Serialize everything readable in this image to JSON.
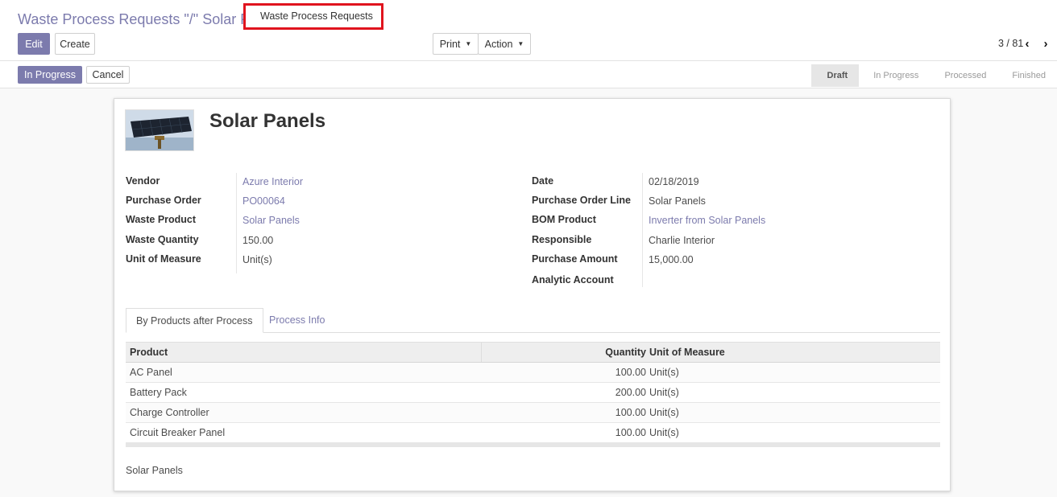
{
  "breadcrumb": "Waste Process Requests \"/\" Solar Panels",
  "tooltip": "Waste Process Requests",
  "buttons": {
    "edit": "Edit",
    "create": "Create",
    "print": "Print",
    "action": "Action"
  },
  "pager": {
    "value": "3 / 81"
  },
  "statusbar": {
    "buttons": {
      "in_progress": "In Progress",
      "cancel": "Cancel"
    },
    "stages": [
      {
        "label": "Draft",
        "active": true
      },
      {
        "label": "In Progress",
        "active": false
      },
      {
        "label": "Processed",
        "active": false
      },
      {
        "label": "Finished",
        "active": false
      }
    ]
  },
  "record": {
    "title": "Solar Panels",
    "left_fields": [
      {
        "label": "Vendor",
        "value": "Azure Interior",
        "link": true
      },
      {
        "label": "Purchase Order",
        "value": "PO00064",
        "link": true
      },
      {
        "label": "Waste Product",
        "value": "Solar Panels",
        "link": true
      },
      {
        "label": "Waste Quantity",
        "value": "150.00",
        "link": false
      },
      {
        "label": "Unit of Measure",
        "value": "Unit(s)",
        "link": false
      }
    ],
    "right_fields": [
      {
        "label": "Date",
        "value": "02/18/2019",
        "link": false
      },
      {
        "label": "Purchase Order Line",
        "value": "Solar Panels",
        "link": false
      },
      {
        "label": "BOM Product",
        "value": "Inverter from Solar Panels",
        "link": true
      },
      {
        "label": "Responsible",
        "value": "Charlie Interior",
        "link": false
      },
      {
        "label": "Purchase Amount",
        "value": "15,000.00",
        "link": false
      },
      {
        "label": "Analytic Account",
        "value": "",
        "link": false
      }
    ]
  },
  "tabs": [
    {
      "label": "By Products after Process",
      "active": true
    },
    {
      "label": "Process Info",
      "active": false
    }
  ],
  "table": {
    "headers": {
      "product": "Product",
      "quantity": "Quantity",
      "uom": "Unit of Measure"
    },
    "rows": [
      {
        "product": "AC Panel",
        "quantity": "100.00",
        "uom": "Unit(s)"
      },
      {
        "product": "Battery Pack",
        "quantity": "200.00",
        "uom": "Unit(s)"
      },
      {
        "product": "Charge Controller",
        "quantity": "100.00",
        "uom": "Unit(s)"
      },
      {
        "product": "Circuit Breaker Panel",
        "quantity": "100.00",
        "uom": "Unit(s)"
      }
    ]
  },
  "note": "Solar Panels",
  "colors": {
    "primary": "#7c7bad",
    "tooltip_border": "#e0141e"
  }
}
